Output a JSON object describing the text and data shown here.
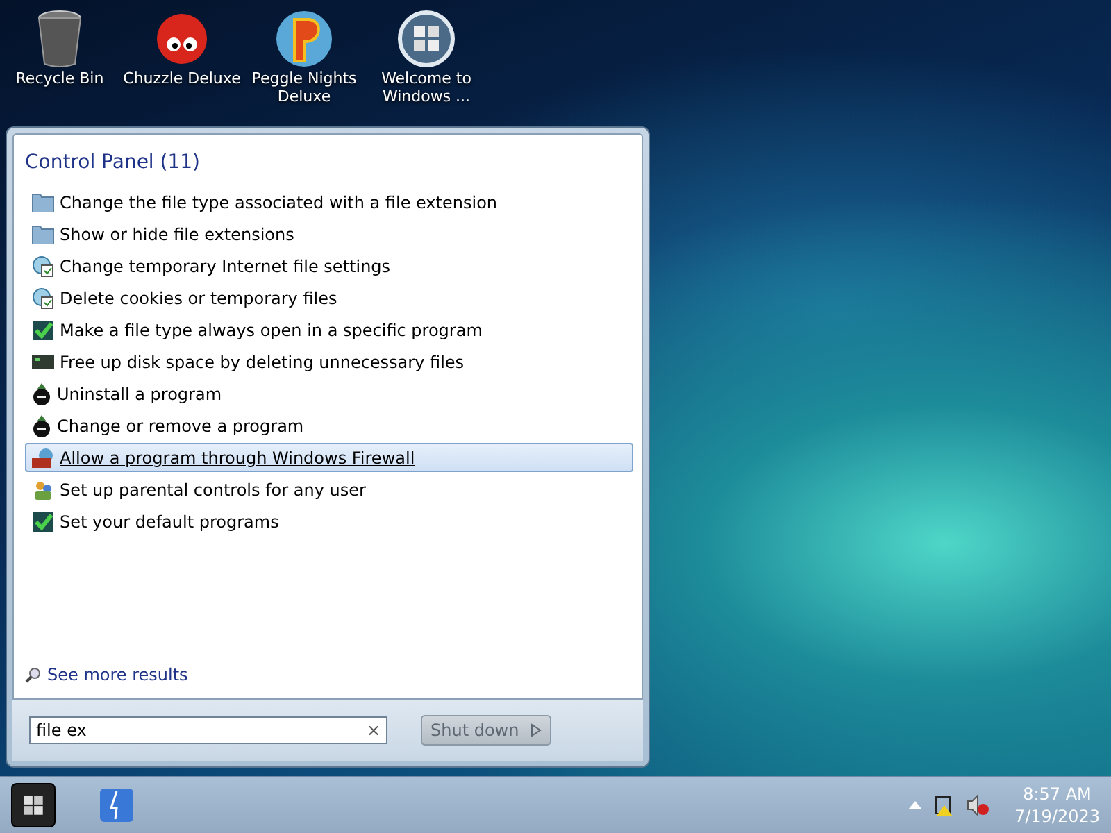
{
  "desktop_icons": [
    {
      "kind": "bin",
      "label": "Recycle Bin"
    },
    {
      "kind": "fuzzball",
      "label": "Chuzzle Deluxe"
    },
    {
      "kind": "peggle",
      "label": "Peggle Nights Deluxe"
    },
    {
      "kind": "welcome",
      "label": "Welcome to Windows ..."
    }
  ],
  "start_menu": {
    "group_title": "Control Panel (11)",
    "items": [
      {
        "kind": "folder",
        "label": "Change the file type associated with a file extension",
        "selected": false
      },
      {
        "kind": "folder",
        "label": "Show or hide file extensions",
        "selected": false
      },
      {
        "kind": "globe",
        "label": "Change temporary Internet file settings",
        "selected": false
      },
      {
        "kind": "globe",
        "label": "Delete cookies or temporary files",
        "selected": false
      },
      {
        "kind": "check",
        "label": "Make a file type always open in a specific program",
        "selected": false
      },
      {
        "kind": "disk",
        "label": "Free up disk space by deleting unnecessary files",
        "selected": false
      },
      {
        "kind": "program",
        "label": "Uninstall a program",
        "selected": false
      },
      {
        "kind": "program",
        "label": "Change or remove a program",
        "selected": false
      },
      {
        "kind": "firewall",
        "label": "Allow a program through Windows Firewall",
        "selected": true
      },
      {
        "kind": "parental",
        "label": "Set up parental controls for any user",
        "selected": false
      },
      {
        "kind": "check",
        "label": "Set your default programs",
        "selected": false
      }
    ],
    "see_more": "See more results",
    "search": {
      "value": "file ex",
      "clear": "×"
    },
    "shutdown": {
      "label": "Shut down",
      "disabled": true
    }
  },
  "taskbar": {
    "time": "8:57 AM",
    "date": "7/19/2023"
  }
}
